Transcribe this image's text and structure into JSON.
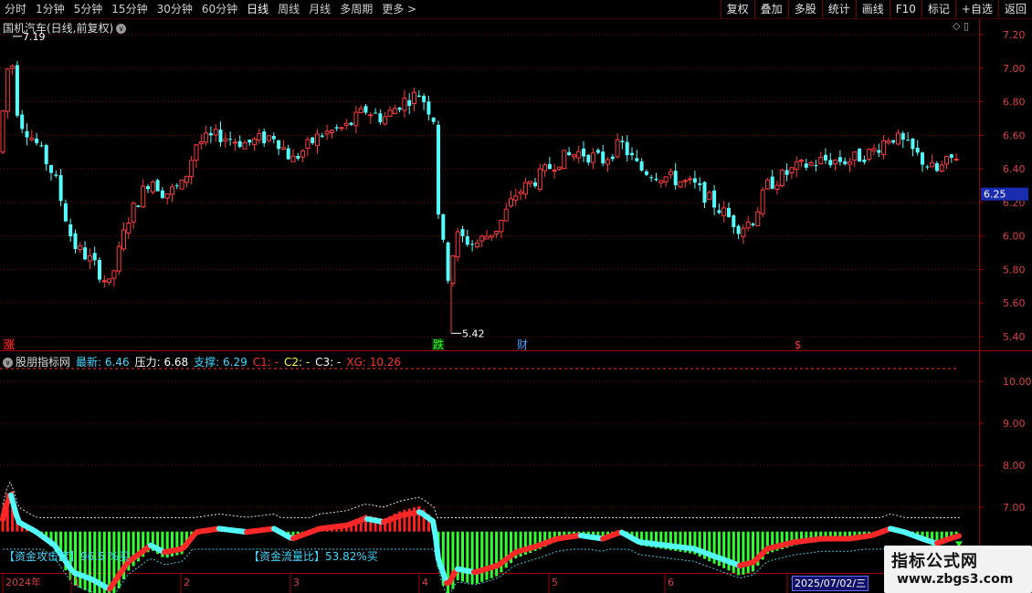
{
  "toolbar": {
    "left_items": [
      "分时",
      "1分钟",
      "5分钟",
      "15分钟",
      "30分钟",
      "60分钟",
      "日线",
      "周线",
      "月线",
      "多周期",
      "更多 >"
    ],
    "active": "日线",
    "right_buttons": [
      "复权",
      "叠加",
      "多股",
      "统计",
      "画线",
      "F10",
      "标记",
      "+自选",
      "返回"
    ]
  },
  "main": {
    "title": "国机汽车(日线,前复权)",
    "icons": [
      "diamond-icon",
      "layout-icon"
    ],
    "price_axis": [
      "7.20",
      "7.00",
      "6.80",
      "6.60",
      "6.40",
      "6.20",
      "6.00",
      "5.80",
      "5.60",
      "5.40"
    ],
    "current_price_tag": "6.25",
    "high_annotation": "7.19",
    "low_annotation": "5.42",
    "markers": [
      {
        "text": "涨",
        "color": "#ff3030"
      },
      {
        "text": "跌",
        "color": "#30ff30"
      },
      {
        "text": "财",
        "color": "#50a0ff"
      },
      {
        "text": "$",
        "color": "#ff3030"
      }
    ]
  },
  "indicator": {
    "name": "股朋指标网",
    "items": [
      {
        "label": "最新: 6.46",
        "color": "#40d8ff"
      },
      {
        "label": "压力: 6.68",
        "color": "#ffffff"
      },
      {
        "label": "支撑: 6.29",
        "color": "#40d8ff"
      },
      {
        "label": "C1: -",
        "color": "#ff3030"
      },
      {
        "label": "C2: -",
        "color": "#ffff40"
      },
      {
        "label": "C3: -",
        "color": "#ffffff"
      },
      {
        "label": "XG: 10.26",
        "color": "#ff3030"
      }
    ],
    "axis": [
      "10.00",
      "9.00",
      "8.00",
      "7.00"
    ],
    "note1": "【资金攻击度】96.5 %买",
    "note2": "【资金流量比】53.82%买"
  },
  "time_axis": [
    "2024年",
    "1",
    "2",
    "3",
    "4",
    "5",
    "6",
    "7"
  ],
  "date_box": "2025/07/02/三",
  "watermark": {
    "title": "指标公式网",
    "url": "www.zbgs3.com"
  },
  "colors": {
    "up": "#ff3c3c",
    "down": "#54ffff",
    "grid": "#8a0000",
    "axis": "#a00000"
  }
}
